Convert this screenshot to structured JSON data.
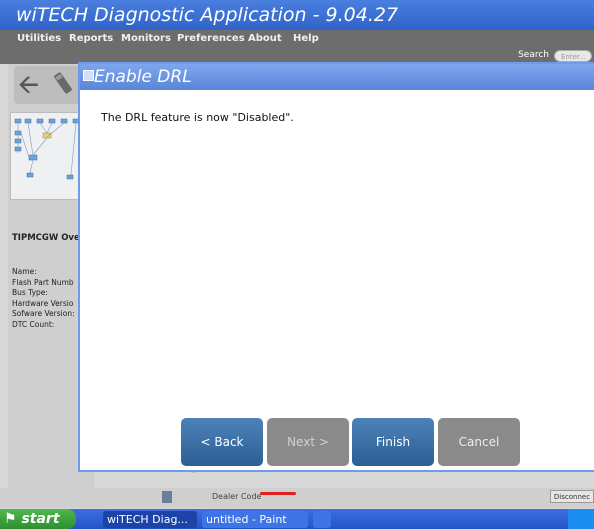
{
  "app": {
    "title": "wiTECH Diagnostic Application - 9.04.27",
    "menu": [
      "Utilities",
      "Reports",
      "Monitors",
      "Preferences",
      "About",
      "Help"
    ],
    "search_label": "Search",
    "search_placeholder": "Enter..."
  },
  "left_panel": {
    "section_title": "TIPMCGW Over",
    "info_labels": [
      "Name:",
      "Flash Part Numb",
      "Bus Type:",
      "Hardware Versio",
      "Sofware Version:",
      "DTC Count:"
    ]
  },
  "status_bar": {
    "dealer_code_label": "Dealer Code",
    "disconnect_label": "Disconnec"
  },
  "dialog": {
    "title": "Enable DRL",
    "message": "The DRL feature is now \"Disabled\".",
    "buttons": {
      "back": "< Back",
      "next": "Next >",
      "finish": "Finish",
      "cancel": "Cancel"
    }
  },
  "taskbar": {
    "start": "start",
    "tasks": [
      "wiTECH Diag...",
      "untitled - Paint"
    ]
  },
  "colors": {
    "title_bar": "#2f63c9",
    "dialog_title": "#5a86d8",
    "button_active": "#2c5f94",
    "button_disabled": "#8a8a8a",
    "start_green": "#2f8f2f"
  }
}
